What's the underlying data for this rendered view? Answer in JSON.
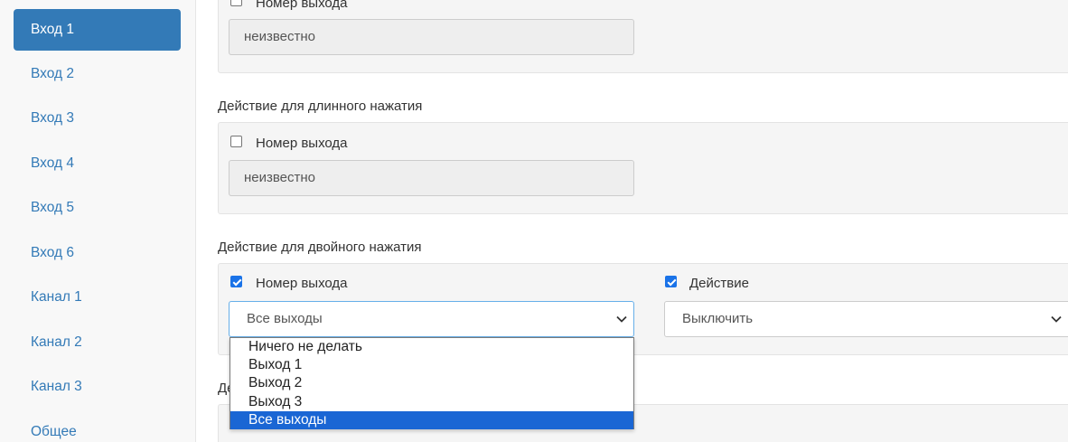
{
  "sidebar": {
    "items": [
      {
        "label": "Вход 1"
      },
      {
        "label": "Вход 2"
      },
      {
        "label": "Вход 3"
      },
      {
        "label": "Вход 4"
      },
      {
        "label": "Вход 5"
      },
      {
        "label": "Вход 6"
      },
      {
        "label": "Канал 1"
      },
      {
        "label": "Канал 2"
      },
      {
        "label": "Канал 3"
      },
      {
        "label": "Общее"
      }
    ],
    "active_index": 0
  },
  "sections": {
    "short_press": {
      "output_checkbox_label": "Номер выхода",
      "output_checked": false,
      "output_value": "неизвестно"
    },
    "long_press": {
      "title": "Действие для длинного нажатия",
      "output_checkbox_label": "Номер выхода",
      "output_checked": false,
      "output_value": "неизвестно"
    },
    "double_press": {
      "title": "Действие для двойного нажатия",
      "output_checkbox_label": "Номер выхода",
      "output_checked": true,
      "output_select_value": "Все выходы",
      "action_checkbox_label": "Действие",
      "action_checked": true,
      "action_select_value": "Выключить"
    },
    "next_section": {
      "title_partial": "Де"
    }
  },
  "dropdown": {
    "options": [
      "Ничего не делать",
      "Выход 1",
      "Выход 2",
      "Выход 3",
      "Все выходы"
    ],
    "selected": "Все выходы"
  },
  "colors": {
    "accent": "#337ab7",
    "option_highlight": "#1a66d4",
    "checkbox_checked": "#1a73e8"
  }
}
